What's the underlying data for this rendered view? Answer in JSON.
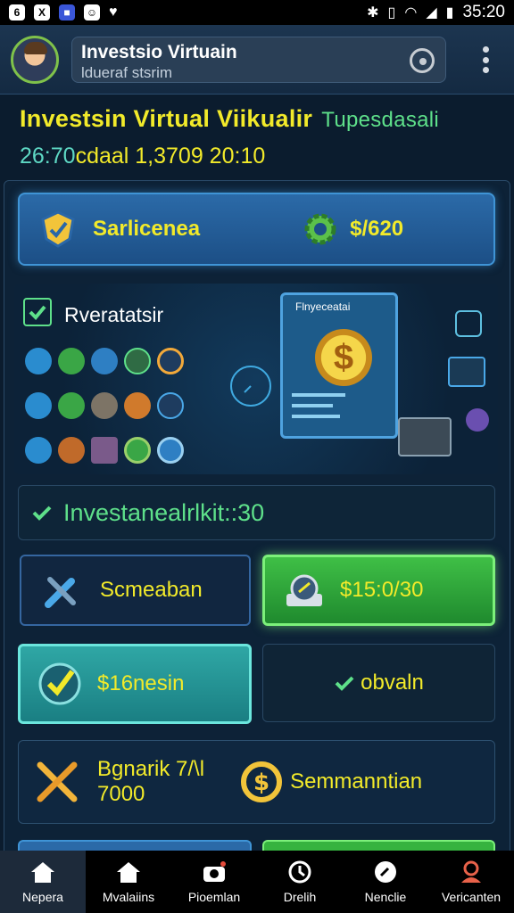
{
  "status_bar": {
    "time": "35:20",
    "left_icons": [
      "6",
      "X",
      "■",
      "☺",
      "♥"
    ]
  },
  "header": {
    "title": "Investsio Virtuain",
    "subtitle": "ldueraf stsrim"
  },
  "heading": {
    "main": "Investsin Virtual Viikualir",
    "side": "Tupesdasali",
    "sub_a": "26:70",
    "sub_b": "cdaal 1,3709 20:10"
  },
  "summary_card": {
    "left_label": "Sarlicenea",
    "right_value": "$/620"
  },
  "illustration": {
    "title": "Rveratatsir",
    "screen_title": "Flnyeceatai"
  },
  "banner": {
    "text": "Investanealrlkit::30"
  },
  "tiles": [
    {
      "label": "Scmeaban"
    },
    {
      "label": "$15:0/30"
    },
    {
      "label": "$16nesin"
    },
    {
      "label": "obvaln"
    },
    {
      "label": "Bgnarik 7/\\l\n7000",
      "right_label": "Semmanntian"
    }
  ],
  "tile5": {
    "left_line1": "Bgnarik 7/\\l",
    "left_line2": "7000",
    "right_label": "Semmanntian"
  },
  "bottom_nav": [
    {
      "label": "Nepera",
      "icon": "home-icon"
    },
    {
      "label": "Mvalaiins",
      "icon": "home-icon"
    },
    {
      "label": "Pioemlan",
      "icon": "camera-icon"
    },
    {
      "label": "Drelih",
      "icon": "clock-icon"
    },
    {
      "label": "Nenclie",
      "icon": "gauge-icon"
    },
    {
      "label": "Vericanten",
      "icon": "user-icon"
    }
  ],
  "colors": {
    "accent_yellow": "#f2ea2a",
    "accent_green": "#5ee08a",
    "bg": "#0b1c2e"
  }
}
